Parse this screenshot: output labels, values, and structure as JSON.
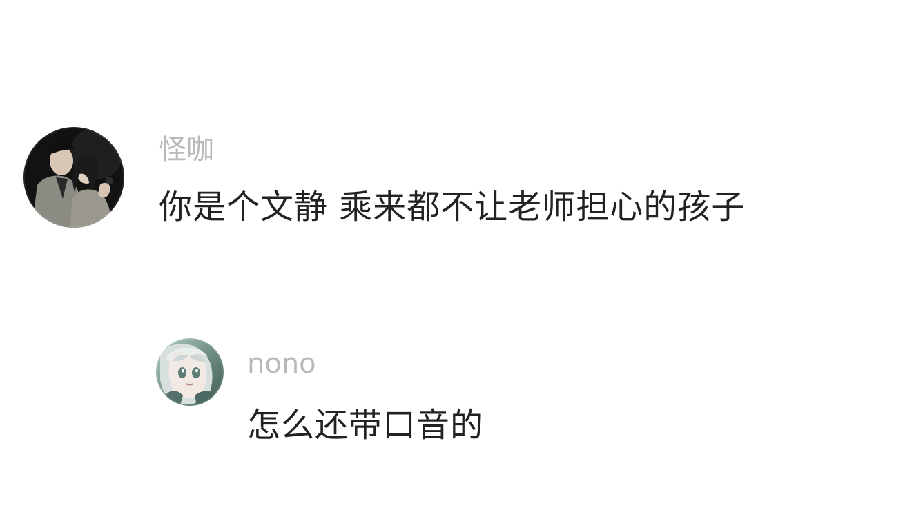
{
  "comments": [
    {
      "username": "怪咖",
      "text": "你是个文静 乘来都不让老师担心的孩子"
    }
  ],
  "reply": {
    "username": "nono",
    "text": "怎么还带口音的"
  }
}
